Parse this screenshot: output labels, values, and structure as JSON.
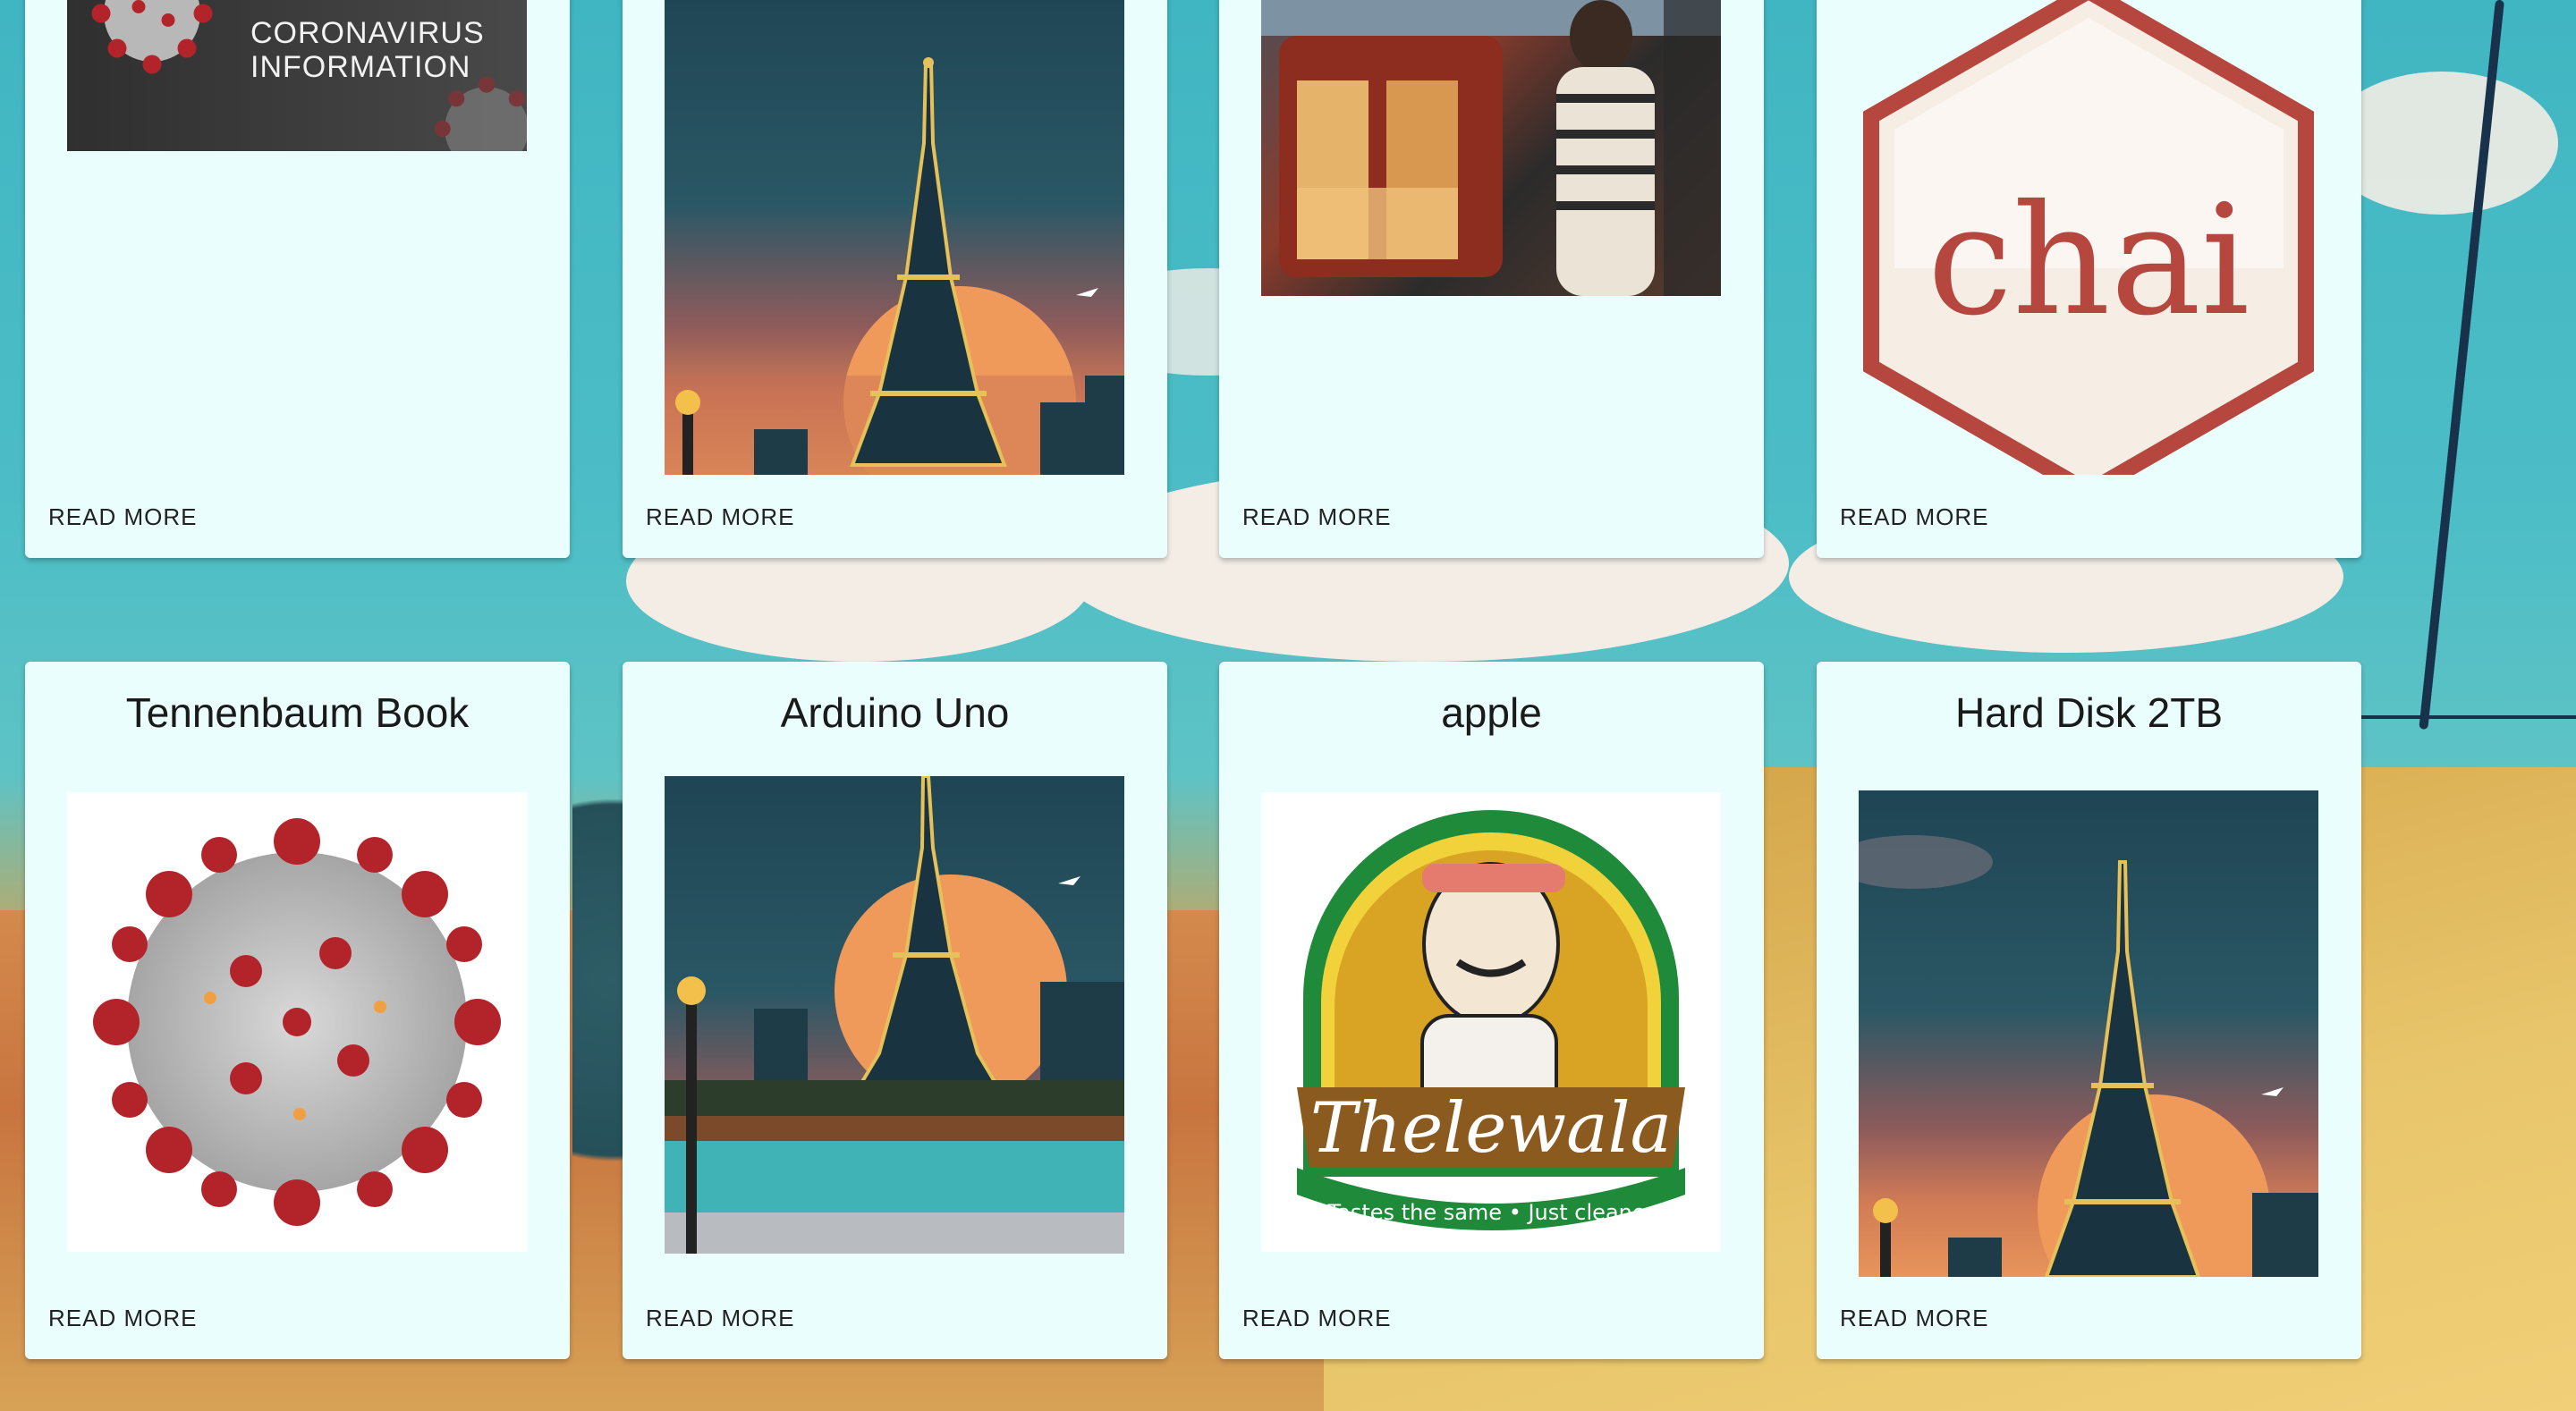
{
  "cards_row1": [
    {
      "title": "",
      "read_more": "READ MORE",
      "image": "coronavirus-banner",
      "image_caption_line1": "CORONAVIRUS",
      "image_caption_line2": "INFORMATION"
    },
    {
      "title": "",
      "read_more": "READ MORE",
      "image": "paris-eiffel-illustration"
    },
    {
      "title": "",
      "read_more": "READ MORE",
      "image": "street-vendor-photo"
    },
    {
      "title": "",
      "read_more": "READ MORE",
      "image": "chai-logo",
      "logo_text": "chai"
    }
  ],
  "cards_row2": [
    {
      "title": "Tennenbaum Book",
      "read_more": "READ MORE",
      "image": "coronavirus-model"
    },
    {
      "title": "Arduino Uno",
      "read_more": "READ MORE",
      "image": "paris-eiffel-illustration"
    },
    {
      "title": "apple",
      "read_more": "READ MORE",
      "image": "thelewala-logo",
      "logo_text": "Thelewala",
      "logo_tagline": "Tastes the same • Just cleaner"
    },
    {
      "title": "Hard Disk 2TB",
      "read_more": "READ MORE",
      "image": "paris-eiffel-illustration"
    }
  ],
  "colors": {
    "card_bg": "#ebfefe",
    "text": "#1a1a1a",
    "chai_red": "#b5473f",
    "thelewala_green": "#1e8a3a"
  }
}
